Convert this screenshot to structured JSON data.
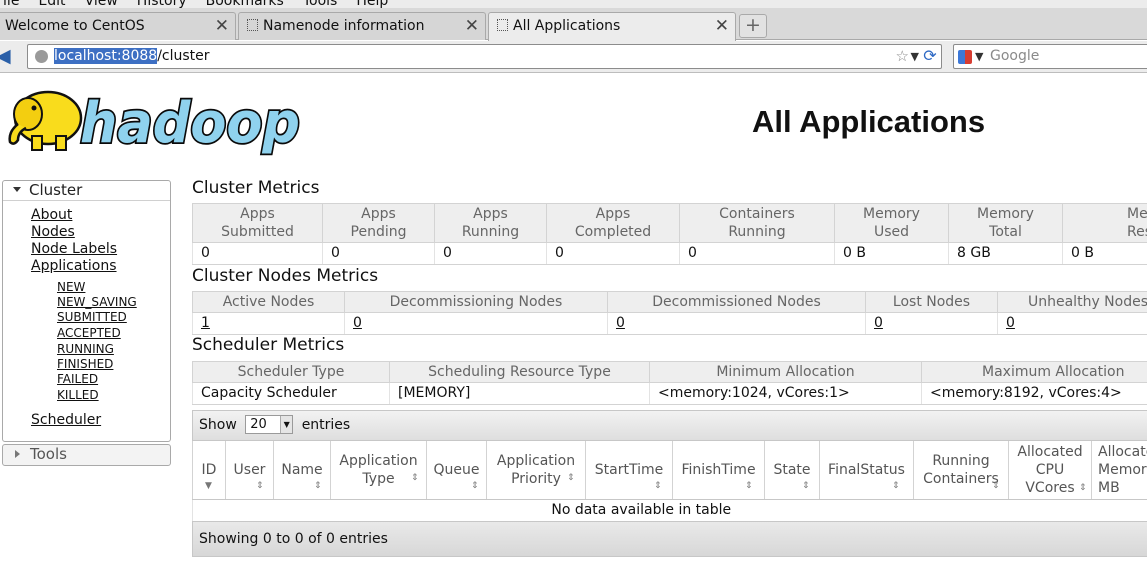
{
  "browser": {
    "menu": [
      "File",
      "Edit",
      "View",
      "History",
      "Bookmarks",
      "Tools",
      "Help"
    ],
    "tabs": [
      {
        "title": "Welcome to CentOS"
      },
      {
        "title": "Namenode information"
      },
      {
        "title": "All Applications"
      }
    ],
    "url": {
      "host": "localhost:8088",
      "path": "/cluster"
    },
    "search_placeholder": "Google"
  },
  "page": {
    "title": "All Applications",
    "logo_text": "hadoop"
  },
  "sidebar": {
    "cluster": {
      "label": "Cluster",
      "links": [
        "About",
        "Nodes",
        "Node Labels",
        "Applications"
      ],
      "app_states": [
        "NEW",
        "NEW_SAVING",
        "SUBMITTED",
        "ACCEPTED",
        "RUNNING",
        "FINISHED",
        "FAILED",
        "KILLED"
      ],
      "scheduler": "Scheduler"
    },
    "tools": {
      "label": "Tools"
    }
  },
  "cluster_metrics": {
    "title": "Cluster Metrics",
    "headers": [
      [
        "Apps",
        "Submitted"
      ],
      [
        "Apps",
        "Pending"
      ],
      [
        "Apps",
        "Running"
      ],
      [
        "Apps",
        "Completed"
      ],
      [
        "Containers",
        "Running"
      ],
      [
        "Memory",
        "Used"
      ],
      [
        "Memory",
        "Total"
      ],
      [
        "Memory",
        "Reserved"
      ]
    ],
    "values": [
      "0",
      "0",
      "0",
      "0",
      "0",
      "0 B",
      "8 GB",
      "0 B"
    ]
  },
  "node_metrics": {
    "title": "Cluster Nodes Metrics",
    "headers": [
      "Active Nodes",
      "Decommissioning Nodes",
      "Decommissioned Nodes",
      "Lost Nodes",
      "Unhealthy Nodes"
    ],
    "values": [
      "1",
      "0",
      "0",
      "0",
      "0"
    ]
  },
  "scheduler_metrics": {
    "title": "Scheduler Metrics",
    "headers": [
      "Scheduler Type",
      "Scheduling Resource Type",
      "Minimum Allocation",
      "Maximum Allocation"
    ],
    "values": [
      "Capacity Scheduler",
      "[MEMORY]",
      "<memory:1024, vCores:1>",
      "<memory:8192, vCores:4>"
    ]
  },
  "apps": {
    "show_label": "Show",
    "page_length": "20",
    "entries_label": "entries",
    "columns": [
      [
        "ID"
      ],
      [
        "User"
      ],
      [
        "Name"
      ],
      [
        "Application",
        "Type"
      ],
      [
        "Queue"
      ],
      [
        "Application",
        "Priority"
      ],
      [
        "StartTime"
      ],
      [
        "FinishTime"
      ],
      [
        "State"
      ],
      [
        "FinalStatus"
      ],
      [
        "Running",
        "Containers"
      ],
      [
        "Allocated",
        "CPU",
        "VCores"
      ],
      [
        "Allocated",
        "Memory",
        "MB"
      ]
    ],
    "empty_message": "No data available in table",
    "info": "Showing 0 to 0 of 0 entries"
  }
}
